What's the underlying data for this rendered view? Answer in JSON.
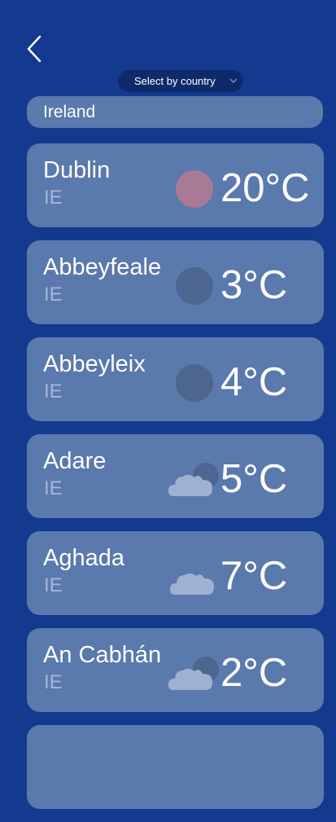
{
  "header": {
    "back_icon": "chevron-left-icon"
  },
  "country_select": {
    "label": "Select by country"
  },
  "country_field": {
    "value": "Ireland"
  },
  "cities": [
    {
      "name": "Dublin",
      "code": "IE",
      "temp": "20°C",
      "icon": "sun-icon"
    },
    {
      "name": "Abbeyfeale",
      "code": "IE",
      "temp": "3°C",
      "icon": "moon-icon"
    },
    {
      "name": "Abbeyleix",
      "code": "IE",
      "temp": "4°C",
      "icon": "moon-icon"
    },
    {
      "name": "Adare",
      "code": "IE",
      "temp": "5°C",
      "icon": "cloud-moon-icon"
    },
    {
      "name": "Aghada",
      "code": "IE",
      "temp": "7°C",
      "icon": "cloud-icon"
    },
    {
      "name": "An Cabhán",
      "code": "IE",
      "temp": "2°C",
      "icon": "cloud-moon-icon"
    },
    {
      "name": "",
      "code": "",
      "temp": "",
      "icon": ""
    }
  ],
  "colors": {
    "background": "#133a8f",
    "card": "#5a79ad",
    "select": "#0e2a6b",
    "sun": "#a97a96",
    "moon": "#4d6690",
    "cloud": "#9fb1d3",
    "code_text": "#a7b5d6"
  }
}
